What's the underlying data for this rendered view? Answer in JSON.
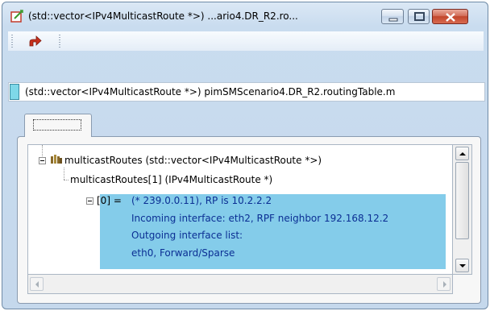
{
  "window": {
    "title": "(std::vector<IPv4MulticastRoute *>) ...ario4.DR_R2.ro...",
    "accent_color": "#84ccea",
    "buttons": [
      "minimize",
      "maximize",
      "close"
    ]
  },
  "toolbar": {
    "items": [
      {
        "icon": "go-up-icon"
      }
    ]
  },
  "address": {
    "text": "(std::vector<IPv4MulticastRoute *>) pimSMScenario4.DR_R2.routingTable.m"
  },
  "tab": {
    "label": ""
  },
  "tree": {
    "root": {
      "label": "multicastRoutes (std::vector<IPv4MulticastRoute *>)"
    },
    "child": {
      "label": "multicastRoutes[1] (IPv4MulticastRoute *)"
    },
    "entry": {
      "prefix": "[0] = ",
      "lines": [
        "(* 239.0.0.11),  RP is 10.2.2.2",
        "Incoming interface: eth2, RPF neighbor 192.168.12.2",
        "Outgoing interface list:",
        "eth0, Forward/Sparse"
      ]
    }
  }
}
